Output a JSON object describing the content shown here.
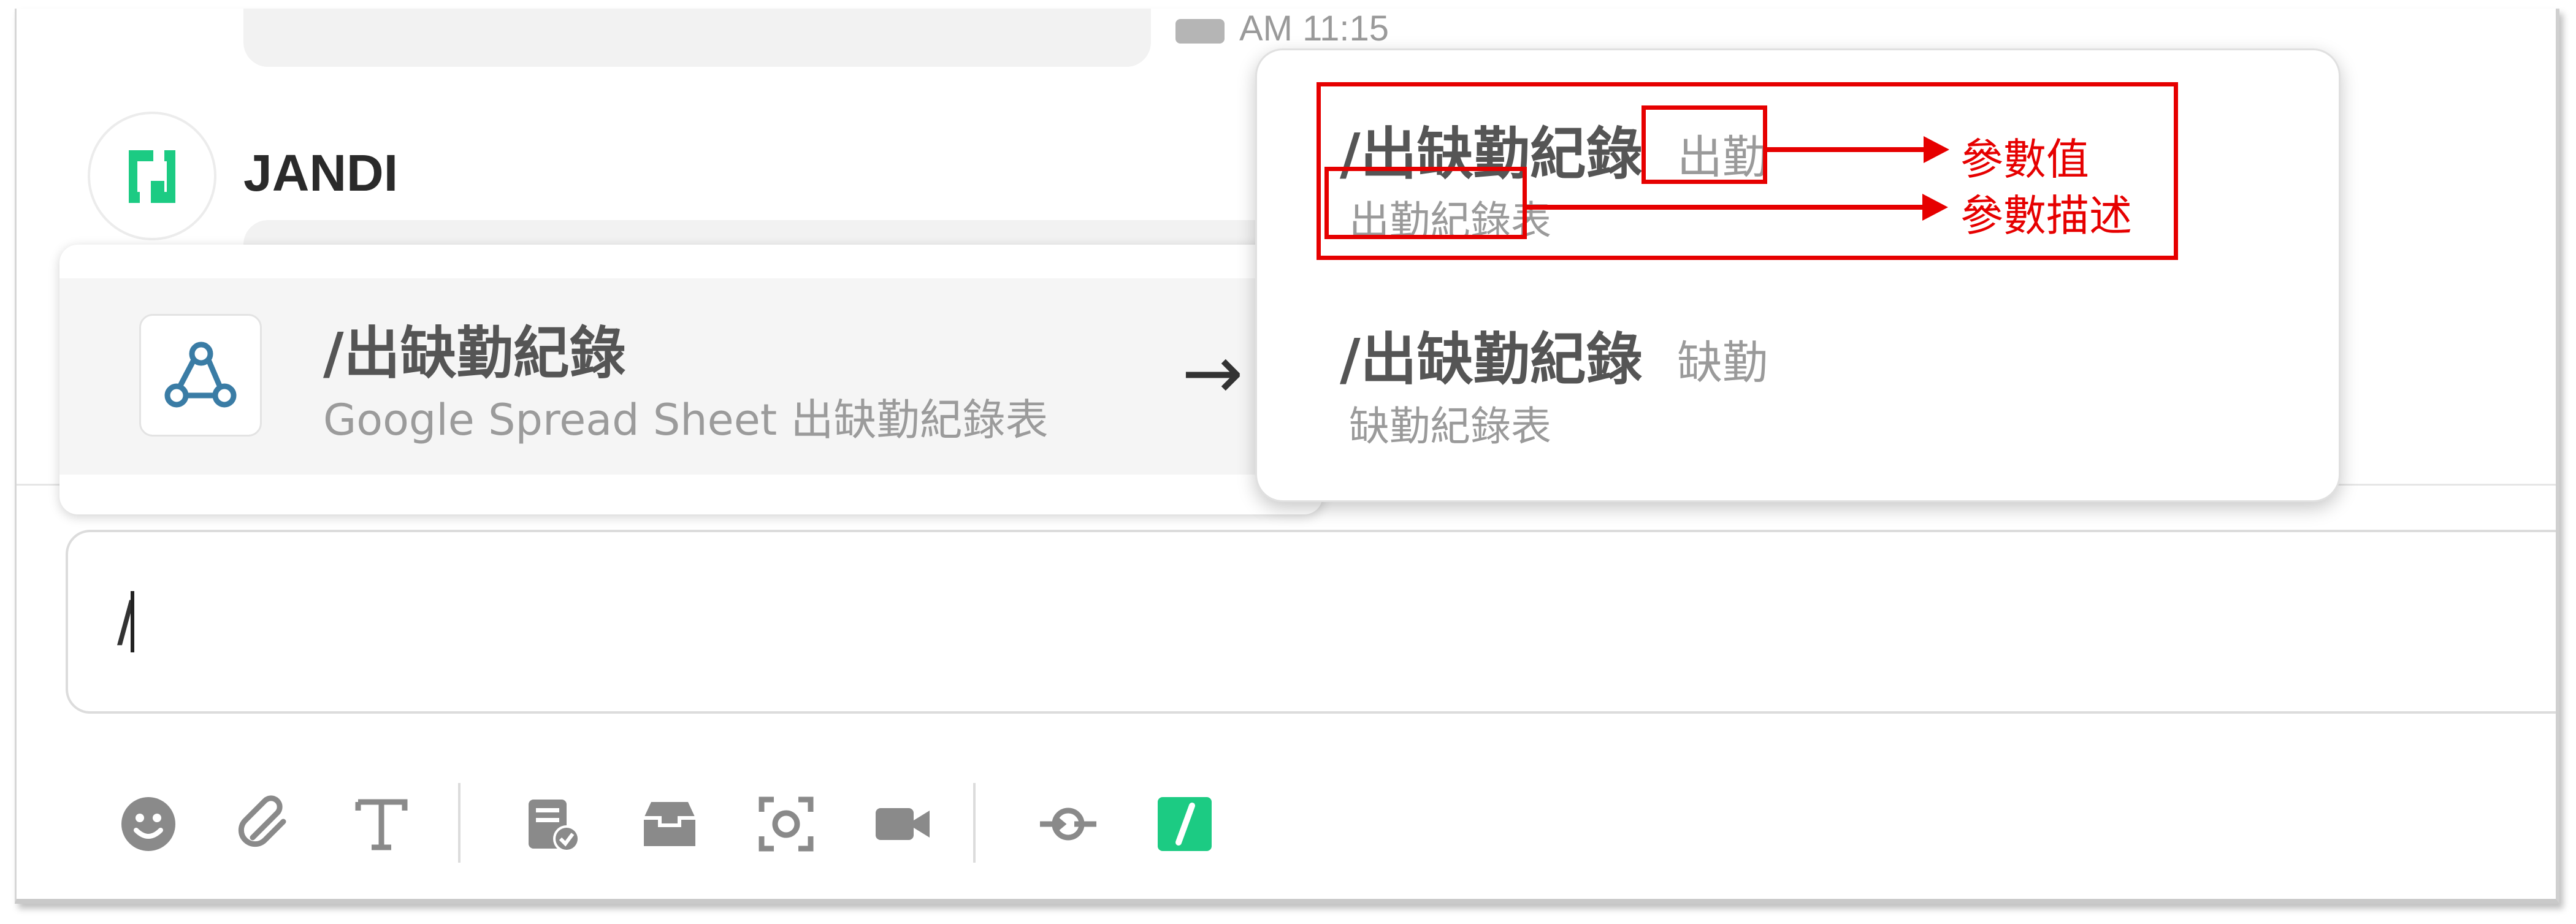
{
  "chat": {
    "previous_time": "AM 11:15",
    "sender_name": "JANDI"
  },
  "command": {
    "name": "/出缺勤紀錄",
    "description": "Google Spread Sheet 出缺勤紀錄表",
    "arrow": "→"
  },
  "params": [
    {
      "command": "/出缺勤紀錄",
      "value": "出勤",
      "description": "出勤紀錄表"
    },
    {
      "command": "/出缺勤紀錄",
      "value": "缺勤",
      "description": "缺勤紀錄表"
    }
  ],
  "annotations": {
    "value_label": "參數值",
    "description_label": "參數描述"
  },
  "input": {
    "value": "/"
  },
  "toolbar": {
    "icons": [
      "emoji-icon",
      "attachment-icon",
      "text-format-icon",
      "todo-icon",
      "archive-icon",
      "screen-capture-icon",
      "video-call-icon",
      "integration-icon",
      "slash-command-icon"
    ]
  },
  "colors": {
    "brand_green": "#1ccb83",
    "annotation_red": "#e60000"
  }
}
